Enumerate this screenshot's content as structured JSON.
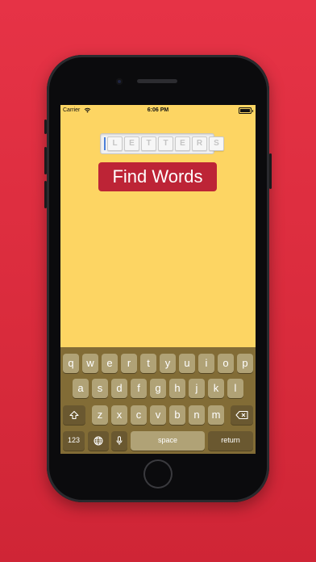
{
  "status_bar": {
    "carrier": "Carrier",
    "time": "6:06 PM"
  },
  "letters_field": {
    "placeholder_letters": [
      "L",
      "E",
      "T",
      "T",
      "E",
      "R",
      "S"
    ]
  },
  "find_button": {
    "label": "Find Words"
  },
  "keyboard": {
    "row1": [
      "q",
      "w",
      "e",
      "r",
      "t",
      "y",
      "u",
      "i",
      "o",
      "p"
    ],
    "row2": [
      "a",
      "s",
      "d",
      "f",
      "g",
      "h",
      "j",
      "k",
      "l"
    ],
    "row3": [
      "z",
      "x",
      "c",
      "v",
      "b",
      "n",
      "m"
    ],
    "numbers_label": "123",
    "space_label": "space",
    "return_label": "return",
    "icons": {
      "shift": "shift-icon",
      "delete": "delete-icon",
      "globe": "globe-icon",
      "mic": "mic-icon"
    }
  },
  "colors": {
    "background": "#e0303f",
    "screen": "#fdd563",
    "button": "#bd2436",
    "keyboard": "#826c36",
    "key": "#b0a276"
  }
}
